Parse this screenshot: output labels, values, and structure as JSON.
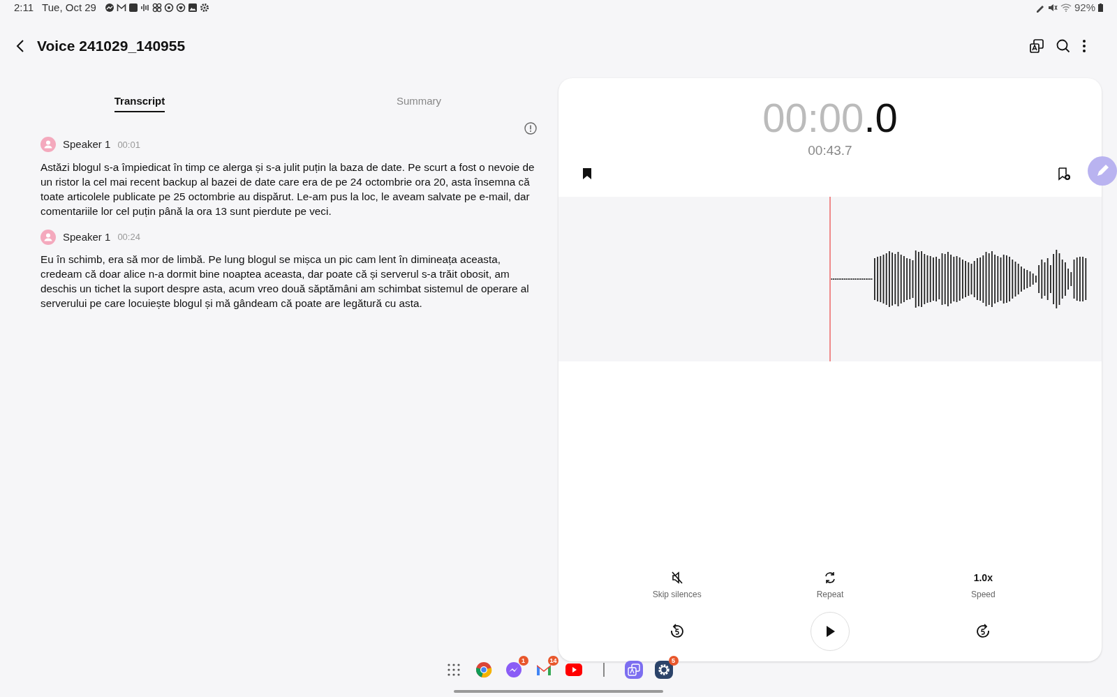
{
  "status_bar": {
    "time": "2:11",
    "date": "Tue, Oct 29",
    "battery": "92%"
  },
  "header": {
    "title": "Voice 241029_140955"
  },
  "tabs": [
    {
      "label": "Transcript",
      "selected": true
    },
    {
      "label": "Summary",
      "selected": false
    }
  ],
  "transcript": [
    {
      "speaker": "Speaker 1",
      "time": "00:01",
      "text": "Astăzi blogul s-a împiedicat în timp ce alerga și s-a julit puțin la baza de date. Pe scurt a fost o nevoie de un ristor la cel mai recent backup al bazei de date care era de pe 24 octombrie ora 20, asta însemna că toate articolele publicate pe 25 octombrie au dispărut. Le-am pus la loc, le aveam salvate pe e-mail, dar comentariile lor cel puțin până la ora 13 sunt pierdute pe veci."
    },
    {
      "speaker": "Speaker 1",
      "time": "00:24",
      "text": "Eu în schimb, era să mor de limbă. Pe lung blogul se mișca un pic cam lent în dimineața aceasta, credeam că doar alice n-a dormit bine noaptea aceasta, dar poate că și serverul s-a trăit obosit, am deschis un tichet la suport despre asta, acum vreo două săptămâni am schimbat sistemul de operare al serverului pe care locuiește blogul și mă gândeam că poate are legătură cu asta."
    }
  ],
  "player": {
    "elapsed": "00:00",
    "fraction": ".0",
    "duration": "00:43.7",
    "options": [
      {
        "kind": "icon",
        "label": "Skip silences"
      },
      {
        "kind": "icon",
        "label": "Repeat"
      },
      {
        "kind": "value",
        "value": "1.0x",
        "label": "Speed"
      }
    ]
  },
  "dock": [
    {
      "kind": "apps"
    },
    {
      "kind": "chrome"
    },
    {
      "kind": "messenger",
      "badge": "1"
    },
    {
      "kind": "gmail",
      "badge": "14"
    },
    {
      "kind": "youtube"
    },
    {
      "kind": "divider"
    },
    {
      "kind": "translate"
    },
    {
      "kind": "settings",
      "badge": "5"
    }
  ]
}
